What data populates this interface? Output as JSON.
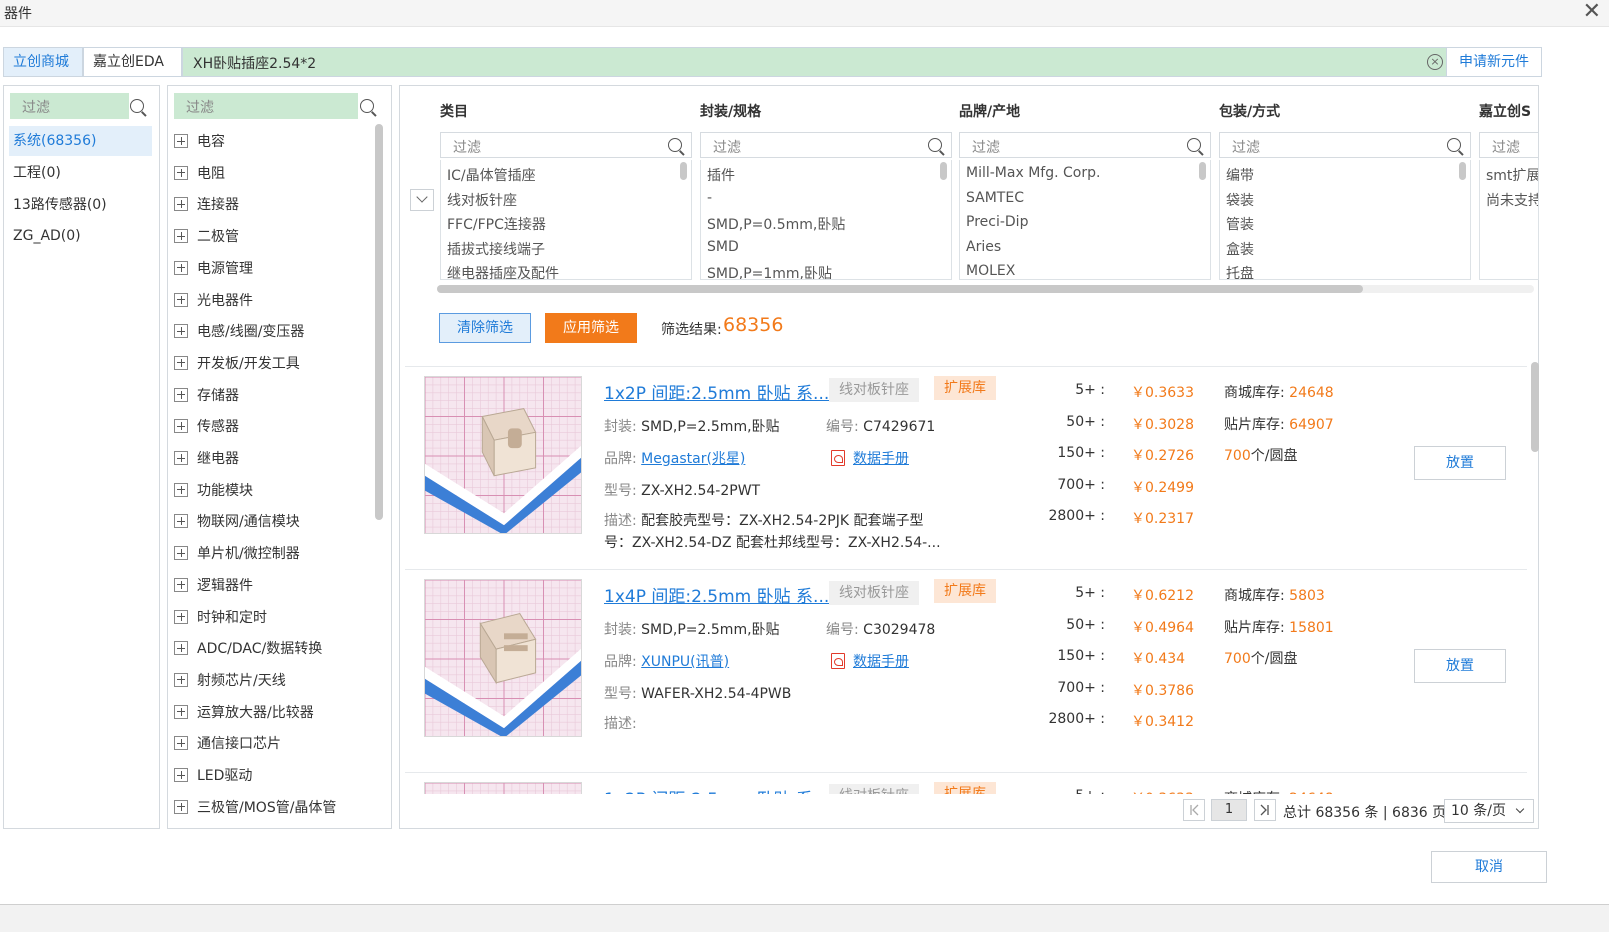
{
  "window": {
    "title": "器件",
    "close_icon": "close-icon"
  },
  "search": {
    "tabs": [
      "立创商城",
      "嘉立创EDA"
    ],
    "query": "XH卧贴插座2.54*2",
    "new_part_label": "申请新元件"
  },
  "libraries": {
    "filter_placeholder": "过滤",
    "items": [
      "系统(68356)",
      "工程(0)",
      "13路传感器(0)",
      "ZG_AD(0)"
    ]
  },
  "categories": {
    "filter_placeholder": "过滤",
    "items": [
      "电容",
      "电阻",
      "连接器",
      "二极管",
      "电源管理",
      "光电器件",
      "电感/线圈/变压器",
      "开发板/开发工具",
      "存储器",
      "传感器",
      "继电器",
      "功能模块",
      "物联网/通信模块",
      "单片机/微控制器",
      "逻辑器件",
      "时钟和定时",
      "ADC/DAC/数据转换",
      "射频芯片/天线",
      "运算放大器/比较器",
      "通信接口芯片",
      "LED驱动",
      "三极管/MOS管/晶体管"
    ]
  },
  "filters": {
    "columns": [
      {
        "header": "类目",
        "placeholder": "过滤",
        "options": [
          "IC/晶体管插座",
          "线对板针座",
          "FFC/FPC连接器",
          "插拔式接线端子",
          "继电器插座及配件"
        ]
      },
      {
        "header": "封装/规格",
        "placeholder": "过滤",
        "options": [
          "插件",
          "-",
          "SMD,P=0.5mm,卧贴",
          "SMD",
          "SMD,P=1mm,卧贴"
        ]
      },
      {
        "header": "品牌/产地",
        "placeholder": "过滤",
        "options": [
          "Mill-Max Mfg. Corp.",
          "SAMTEC",
          "Preci-Dip",
          "Aries",
          "MOLEX"
        ]
      },
      {
        "header": "包装/方式",
        "placeholder": "过滤",
        "options": [
          "编带",
          "袋装",
          "管装",
          "盒装",
          "托盘"
        ]
      },
      {
        "header": "嘉立创S",
        "placeholder": "过滤",
        "options": [
          "smt扩展",
          "尚未支持"
        ]
      }
    ],
    "clear_label": "清除筛选",
    "apply_label": "应用筛选",
    "result_label": "筛选结果:",
    "result_count": "68356"
  },
  "products": [
    {
      "name": "1x2P 间距:2.5mm 卧贴 系...",
      "category_tag": "线对板针座",
      "ext_tag": "扩展库",
      "package_label": "封装:",
      "package": "SMD,P=2.5mm,卧贴",
      "code_label": "编号:",
      "code": "C7429671",
      "brand_label": "品牌:",
      "brand": "Megastar(兆星)",
      "datasheet": "数据手册",
      "model_label": "型号:",
      "model": "ZX-XH2.54-2PWT",
      "desc_label": "描述:",
      "desc": "配套胶壳型号：ZX-XH2.54-2PJK 配套端子型号：ZX-XH2.54-DZ 配套杜邦线型号：ZX-XH2.54-...",
      "tiers": [
        "5+ :",
        "50+ :",
        "150+ :",
        "700+ :",
        "2800+ :"
      ],
      "prices": [
        "￥0.3633",
        "￥0.3028",
        "￥0.2726",
        "￥0.2499",
        "￥0.2317"
      ],
      "mall_stock_label": "商城库存:",
      "mall_stock": "24648",
      "smt_stock_label": "贴片库存:",
      "smt_stock": "64907",
      "reel_qty": "700",
      "reel_unit": "个/圆盘",
      "place_label": "放置"
    },
    {
      "name": "1x4P 间距:2.5mm 卧贴 系...",
      "category_tag": "线对板针座",
      "ext_tag": "扩展库",
      "package_label": "封装:",
      "package": "SMD,P=2.5mm,卧贴",
      "code_label": "编号:",
      "code": "C3029478",
      "brand_label": "品牌:",
      "brand": "XUNPU(讯普)",
      "datasheet": "数据手册",
      "model_label": "型号:",
      "model": "WAFER-XH2.54-4PWB",
      "desc_label": "描述:",
      "desc": "",
      "tiers": [
        "5+ :",
        "50+ :",
        "150+ :",
        "700+ :",
        "2800+ :"
      ],
      "prices": [
        "￥0.6212",
        "￥0.4964",
        "￥0.434",
        "￥0.3786",
        "￥0.3412"
      ],
      "mall_stock_label": "商城库存:",
      "mall_stock": "5803",
      "smt_stock_label": "贴片库存:",
      "smt_stock": "15801",
      "reel_qty": "700",
      "reel_unit": "个/圆盘",
      "place_label": "放置"
    }
  ],
  "pagination": {
    "current_page": "1",
    "summary": "总计 68356 条 | 6836 页",
    "page_size": "10 条/页"
  },
  "footer": {
    "cancel_label": "取消"
  },
  "colors": {
    "accent": "#1f7bd8",
    "orange": "#f27a1a",
    "filter_bg": "#cbe9d2"
  }
}
